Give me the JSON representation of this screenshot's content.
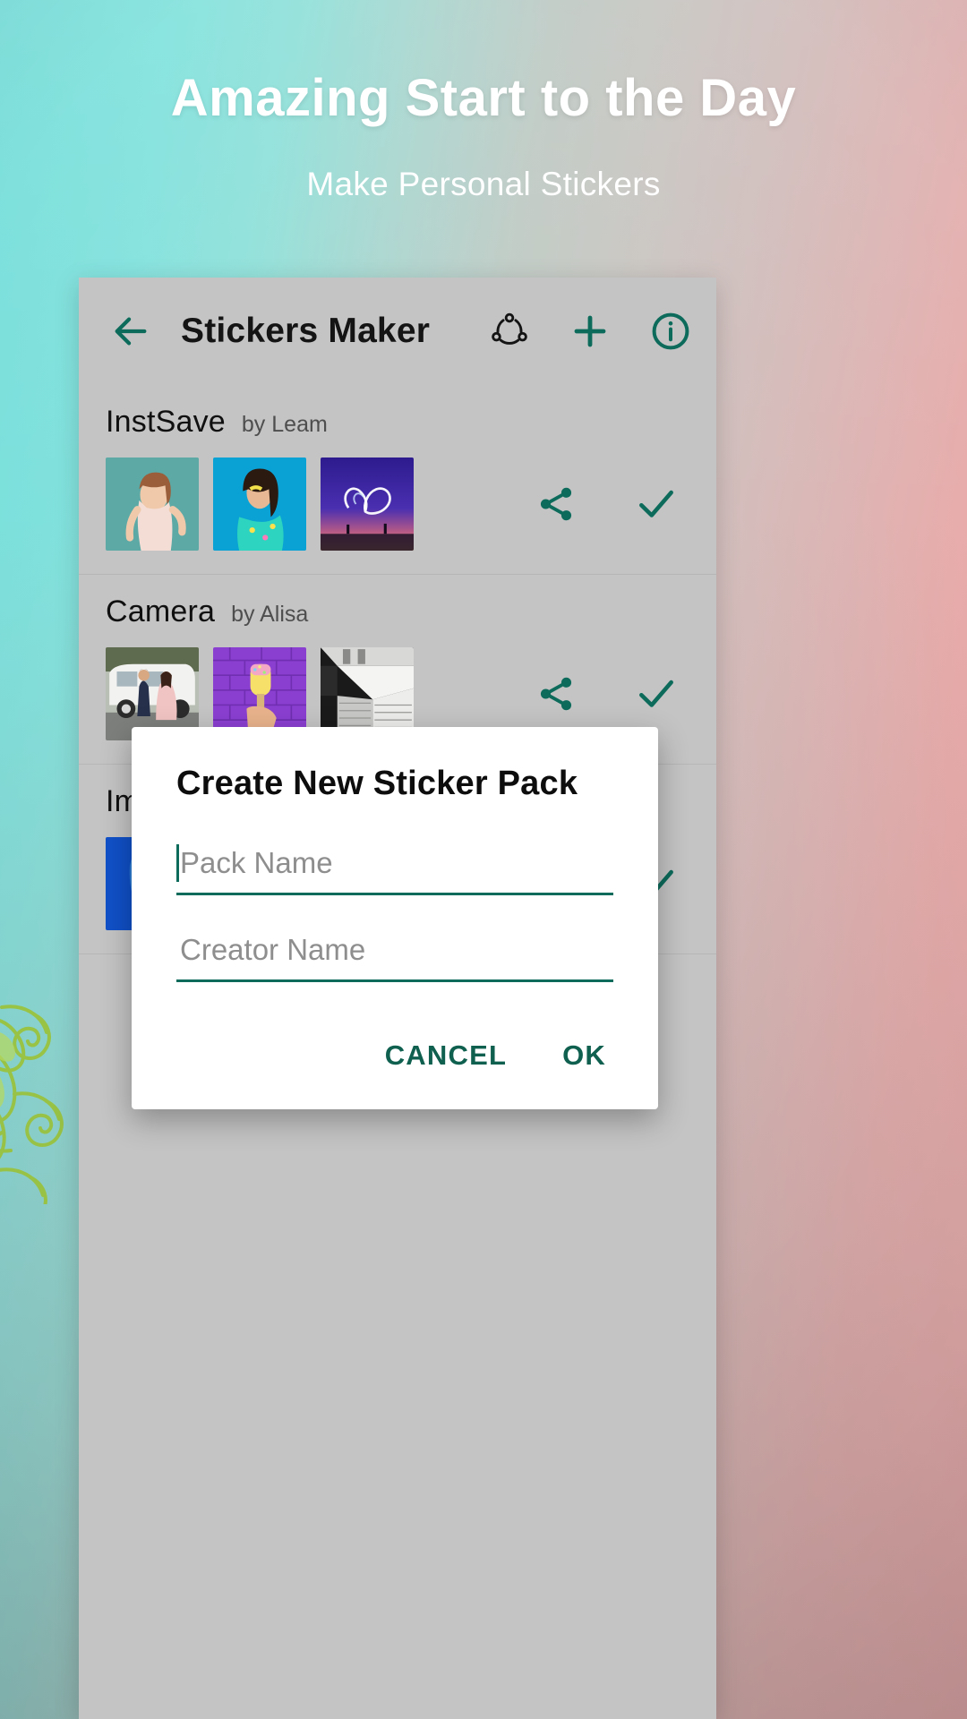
{
  "hero": {
    "title": "Amazing Start to the Day",
    "subtitle": "Make Personal Stickers"
  },
  "colors": {
    "accent": "#0c6b5b",
    "panel": "#c4c4c4",
    "dialog_bg": "#ffffff",
    "hero_text": "#ffffff",
    "gradient_start": "#74ded9",
    "gradient_end": "#f4a3a4"
  },
  "app_bar": {
    "back_icon": "arrow-left-icon",
    "title": "Stickers Maker",
    "actions": [
      {
        "icon": "share-network-icon",
        "name": "network-share-button"
      },
      {
        "icon": "plus-icon",
        "name": "add-pack-button"
      },
      {
        "icon": "info-circle-icon",
        "name": "info-button"
      }
    ]
  },
  "packs": [
    {
      "name": "InstSave",
      "author": "by Leam",
      "thumbs": [
        "woman-teal-portrait",
        "woman-blue-portrait",
        "heart-light-trails"
      ],
      "share_icon": "share-icon",
      "status_icon": "check-icon"
    },
    {
      "name": "Camera",
      "author": "by Alisa",
      "thumbs": [
        "couple-white-van",
        "ice-cream-purple-wall",
        "architecture-white-stairs"
      ],
      "share_icon": "share-icon",
      "status_icon": "check-icon"
    },
    {
      "name": "Im",
      "author": "",
      "thumbs": [
        "blue-face-portrait"
      ],
      "share_icon": "share-icon",
      "status_icon": "check-icon"
    }
  ],
  "dialog": {
    "title": "Create New Sticker Pack",
    "pack_name": {
      "value": "",
      "placeholder": "Pack Name"
    },
    "creator_name": {
      "value": "",
      "placeholder": "Creator Name"
    },
    "cancel_label": "CANCEL",
    "ok_label": "OK"
  }
}
